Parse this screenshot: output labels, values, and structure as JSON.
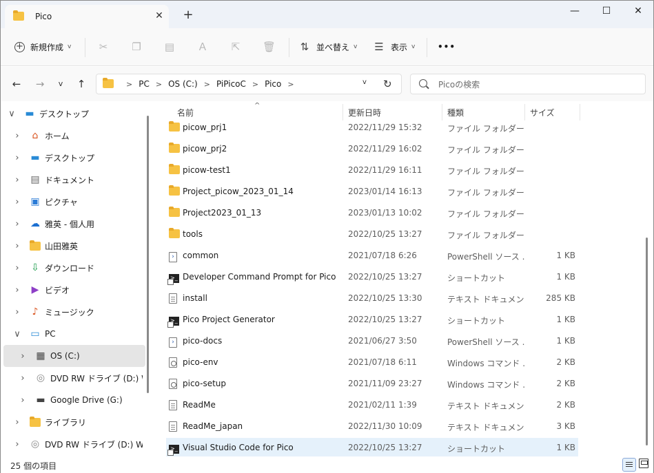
{
  "window": {
    "tab_title": "Pico",
    "minimize": "—",
    "maximize": "☐",
    "close": "✕",
    "tab_close": "✕",
    "new_tab": "+"
  },
  "toolbar": {
    "new_label": "新規作成",
    "sort_label": "並べ替え",
    "view_label": "表示",
    "more_label": "•••"
  },
  "address": {
    "crumbs": [
      "PC",
      "OS (C:)",
      "PiPicoC",
      "Pico"
    ],
    "search_placeholder": "Picoの検索"
  },
  "sidebar": {
    "items": [
      {
        "label": "デスクトップ",
        "icon": "desktop-icon",
        "expander": "v",
        "level": 0
      },
      {
        "label": "ホーム",
        "icon": "home-icon",
        "expander": ">",
        "level": 1
      },
      {
        "label": "デスクトップ",
        "icon": "desktop-icon",
        "expander": ">",
        "level": 1
      },
      {
        "label": "ドキュメント",
        "icon": "documents-icon",
        "expander": ">",
        "level": 1
      },
      {
        "label": "ピクチャ",
        "icon": "pictures-icon",
        "expander": ">",
        "level": 1
      },
      {
        "label": "雅英 - 個人用",
        "icon": "onedrive-icon",
        "expander": ">",
        "level": 1
      },
      {
        "label": "山田雅英",
        "icon": "user-folder-icon",
        "expander": ">",
        "level": 1
      },
      {
        "label": "ダウンロード",
        "icon": "download-icon",
        "expander": ">",
        "level": 1
      },
      {
        "label": "ビデオ",
        "icon": "video-icon",
        "expander": ">",
        "level": 1
      },
      {
        "label": "ミュージック",
        "icon": "music-icon",
        "expander": ">",
        "level": 1
      },
      {
        "label": "PC",
        "icon": "pc-icon",
        "expander": "v",
        "level": 1
      },
      {
        "label": "OS (C:)",
        "icon": "drive-c-icon",
        "expander": ">",
        "level": 2
      },
      {
        "label": "DVD RW ドライブ (D:) WebA",
        "icon": "dvd-icon",
        "expander": ">",
        "level": 2
      },
      {
        "label": "Google Drive (G:)",
        "icon": "google-drive-icon",
        "expander": ">",
        "level": 2
      },
      {
        "label": "ライブラリ",
        "icon": "library-icon",
        "expander": ">",
        "level": 1
      },
      {
        "label": "DVD RW ドライブ (D:) WebAr",
        "icon": "dvd-icon",
        "expander": ">",
        "level": 1
      }
    ]
  },
  "columns": {
    "name": "名前",
    "date": "更新日時",
    "type": "種類",
    "size": "サイズ"
  },
  "files": [
    {
      "name": "picow_prj1",
      "date": "2022/11/29 15:32",
      "type": "ファイル フォルダー",
      "size": "",
      "icon": "folder-icon"
    },
    {
      "name": "picow_prj2",
      "date": "2022/11/29 16:02",
      "type": "ファイル フォルダー",
      "size": "",
      "icon": "folder-icon"
    },
    {
      "name": "picow-test1",
      "date": "2022/11/29 16:11",
      "type": "ファイル フォルダー",
      "size": "",
      "icon": "folder-icon"
    },
    {
      "name": "Project_picow_2023_01_14",
      "date": "2023/01/14 16:13",
      "type": "ファイル フォルダー",
      "size": "",
      "icon": "folder-icon"
    },
    {
      "name": "Project2023_01_13",
      "date": "2023/01/13 10:02",
      "type": "ファイル フォルダー",
      "size": "",
      "icon": "folder-icon"
    },
    {
      "name": "tools",
      "date": "2022/10/25 13:27",
      "type": "ファイル フォルダー",
      "size": "",
      "icon": "folder-icon"
    },
    {
      "name": "common",
      "date": "2021/07/18 6:26",
      "type": "PowerShell ソース ...",
      "size": "1 KB",
      "icon": "powershell-icon"
    },
    {
      "name": "Developer Command Prompt for Pico",
      "date": "2022/10/25 13:27",
      "type": "ショートカット",
      "size": "1 KB",
      "icon": "shortcut-icon"
    },
    {
      "name": "install",
      "date": "2022/10/25 13:30",
      "type": "テキスト ドキュメント",
      "size": "285 KB",
      "icon": "text-icon"
    },
    {
      "name": "Pico Project Generator",
      "date": "2022/10/25 13:27",
      "type": "ショートカット",
      "size": "1 KB",
      "icon": "shortcut-icon"
    },
    {
      "name": "pico-docs",
      "date": "2021/06/27 3:50",
      "type": "PowerShell ソース ...",
      "size": "1 KB",
      "icon": "powershell-icon"
    },
    {
      "name": "pico-env",
      "date": "2021/07/18 6:11",
      "type": "Windows コマンド ...",
      "size": "2 KB",
      "icon": "batch-icon"
    },
    {
      "name": "pico-setup",
      "date": "2021/11/09 23:27",
      "type": "Windows コマンド ...",
      "size": "2 KB",
      "icon": "batch-icon"
    },
    {
      "name": "ReadMe",
      "date": "2021/02/11 1:39",
      "type": "テキスト ドキュメント",
      "size": "2 KB",
      "icon": "text-icon"
    },
    {
      "name": "ReadMe_japan",
      "date": "2022/11/30 10:09",
      "type": "テキスト ドキュメント",
      "size": "3 KB",
      "icon": "text-icon"
    },
    {
      "name": "Visual Studio Code for Pico",
      "date": "2022/10/25 13:27",
      "type": "ショートカット",
      "size": "1 KB",
      "icon": "shortcut-icon",
      "selected": true
    }
  ],
  "status": {
    "item_count": "25 個の項目"
  }
}
